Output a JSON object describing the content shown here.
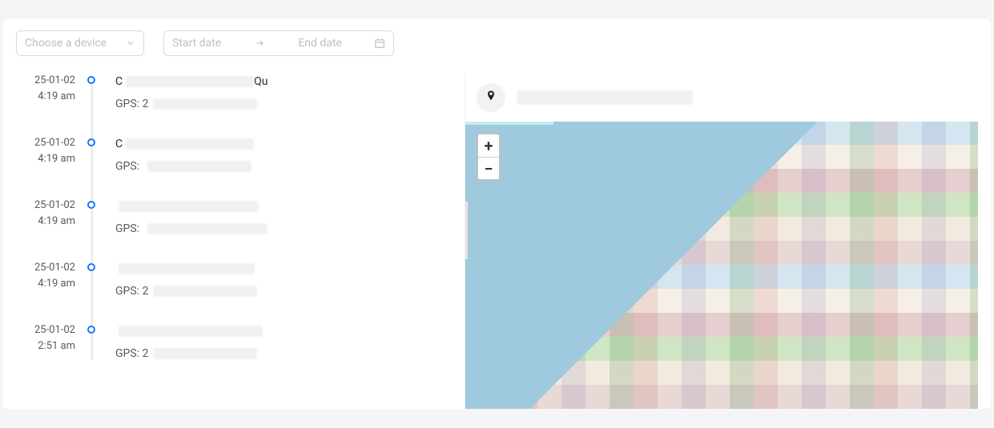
{
  "filters": {
    "device_placeholder": "Choose a device",
    "start_placeholder": "Start date",
    "end_placeholder": "End date"
  },
  "timeline": [
    {
      "date": "25-01-02",
      "time": "4:19 am",
      "title_prefix": "C",
      "title_suffix": "Qu",
      "gps_label": "GPS:",
      "gps_prefix": "2"
    },
    {
      "date": "25-01-02",
      "time": "4:19 am",
      "title_prefix": "C",
      "title_suffix": "",
      "gps_label": "GPS:",
      "gps_prefix": ""
    },
    {
      "date": "25-01-02",
      "time": "4:19 am",
      "title_prefix": "",
      "title_suffix": "",
      "gps_label": "GPS:",
      "gps_prefix": ""
    },
    {
      "date": "25-01-02",
      "time": "4:19 am",
      "title_prefix": "",
      "title_suffix": "",
      "gps_label": "GPS:",
      "gps_prefix": "2"
    },
    {
      "date": "25-01-02",
      "time": "2:51 am",
      "title_prefix": "",
      "title_suffix": "",
      "gps_label": "GPS:",
      "gps_prefix": "2"
    }
  ],
  "map": {
    "zoom_in_label": "+",
    "zoom_out_label": "−"
  }
}
